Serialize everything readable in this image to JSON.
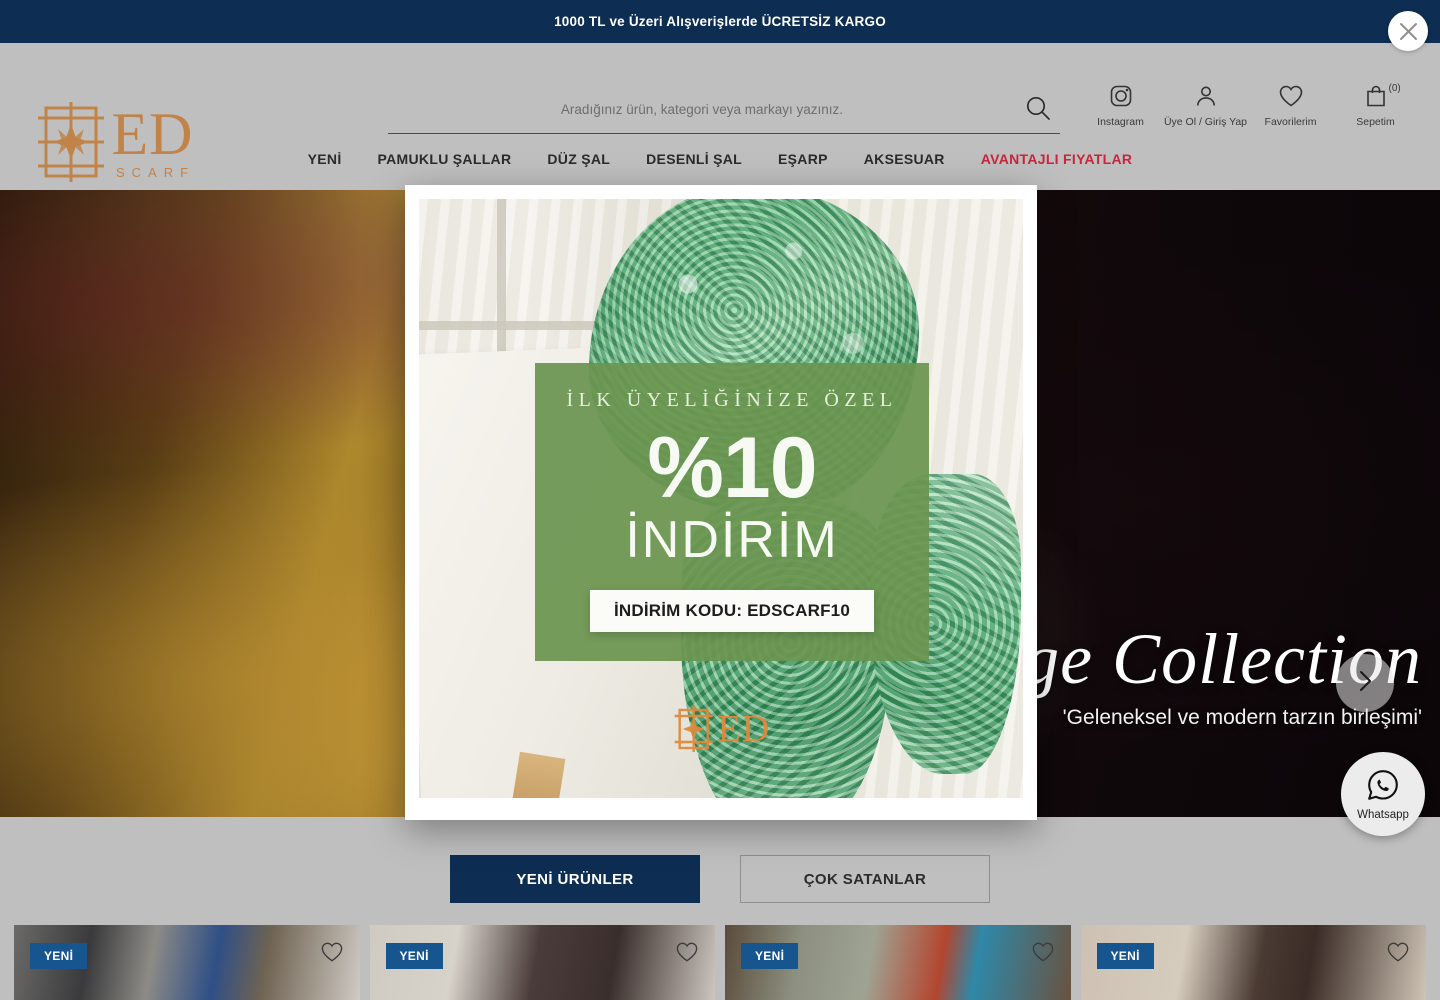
{
  "announcement": {
    "text": "1000 TL ve Üzeri Alışverişlerde ÜCRETSİZ KARGO",
    "close_icon": "close-icon",
    "background": "#0d2d52"
  },
  "brand": {
    "name": "ED",
    "tagline": "SCARF",
    "color": "#c0844b"
  },
  "search": {
    "placeholder": "Aradığınız ürün, kategori veya markayı yazınız.",
    "value": "",
    "icon": "search-icon"
  },
  "header_icons": [
    {
      "icon": "instagram-icon",
      "label": "Instagram"
    },
    {
      "icon": "user-icon",
      "label": "Üye Ol / Giriş Yap"
    },
    {
      "icon": "heart-icon",
      "label": "Favorilerim"
    },
    {
      "icon": "bag-icon",
      "label": "Sepetim",
      "count": "(0)"
    }
  ],
  "nav": {
    "items": [
      {
        "label": "YENİ",
        "accent": false
      },
      {
        "label": "PAMUKLU ŞALLAR",
        "accent": false
      },
      {
        "label": "DÜZ ŞAL",
        "accent": false
      },
      {
        "label": "DESENLİ ŞAL",
        "accent": false
      },
      {
        "label": "EŞARP",
        "accent": false
      },
      {
        "label": "AKSESUAR",
        "accent": false
      },
      {
        "label": "AVANTAJLI FIYATLAR",
        "accent": true
      }
    ],
    "accent_color": "#c8263c"
  },
  "hero": {
    "title": "Heritage Collection",
    "subtitle": "'Geleneksel ve modern tarzın birleşimi'",
    "next_arrow_icon": "chevron-right-icon"
  },
  "modal": {
    "kicker": "İLK ÜYELİĞİNİZE ÖZEL",
    "percent": "%10",
    "label": "İNDİRİM",
    "code_text": "İNDİRİM KODU: EDSCARF10",
    "panel_color": "#6a9450",
    "brand_mark": "ED"
  },
  "whatsapp": {
    "label": "Whatsapp",
    "icon": "whatsapp-icon"
  },
  "tabs": [
    {
      "label": "YENİ ÜRÜNLER",
      "active": true
    },
    {
      "label": "ÇOK SATANLAR",
      "active": false
    }
  ],
  "products": [
    {
      "badge": "YENİ",
      "fav_icon": "heart-icon"
    },
    {
      "badge": "YENİ",
      "fav_icon": "heart-icon"
    },
    {
      "badge": "YENİ",
      "fav_icon": "heart-icon"
    },
    {
      "badge": "YENİ",
      "fav_icon": "heart-icon"
    }
  ],
  "colors": {
    "navy": "#0d2d52",
    "badge_blue": "#17558f",
    "page_bg": "#bfbfbf",
    "gold": "#c0844b",
    "green": "#6a9450"
  }
}
